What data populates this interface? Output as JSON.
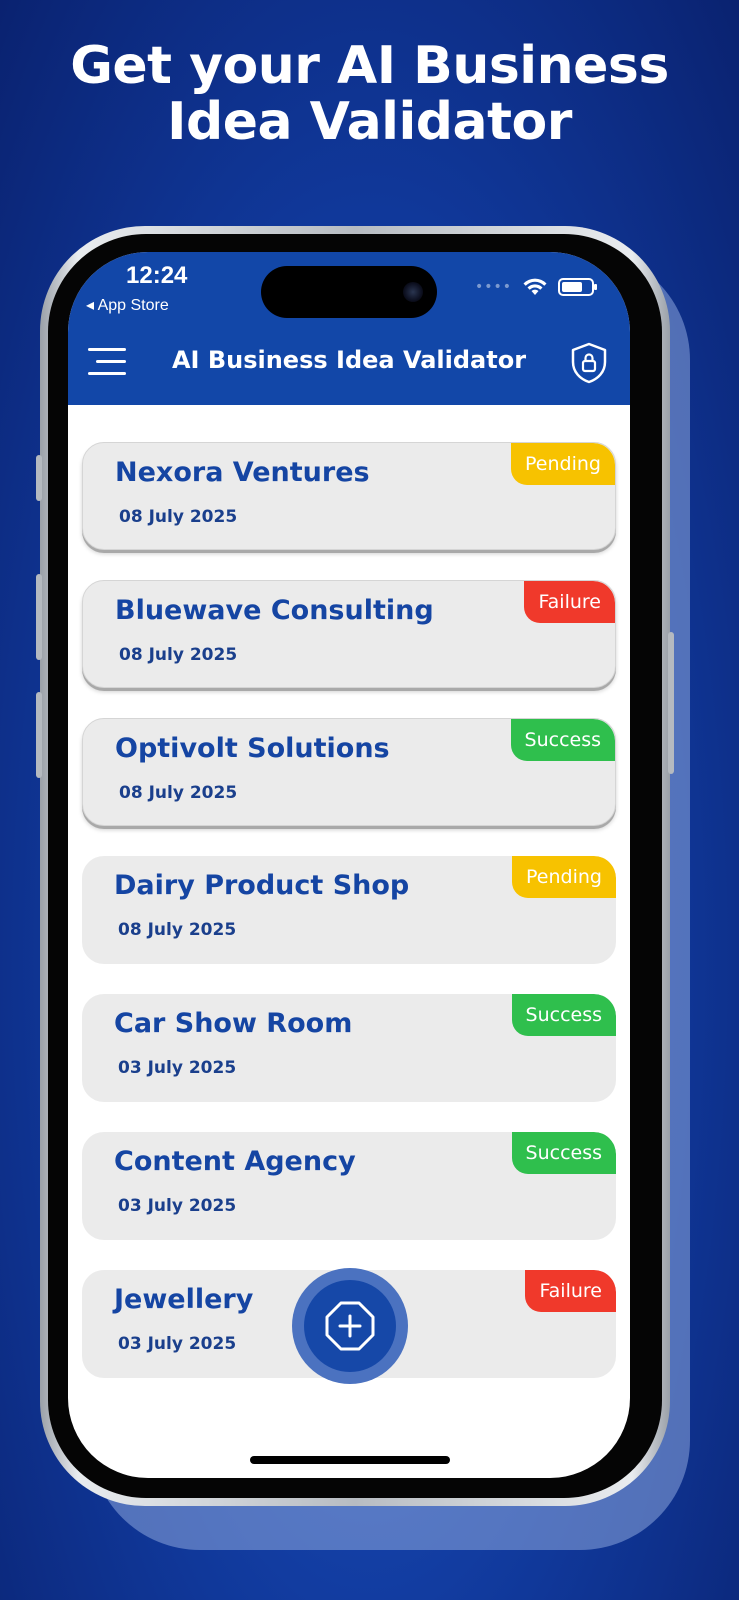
{
  "promo": {
    "title_line1": "Get your AI Business",
    "title_line2": "Idea Validator"
  },
  "status_bar": {
    "time": "12:24",
    "back_label": "◂ App Store",
    "battery_percent": 70
  },
  "header": {
    "title": "AI Business Idea Validator",
    "menu_icon": "menu-icon",
    "right_icon": "shield-lock-icon"
  },
  "ideas": [
    {
      "name": "Nexora Ventures",
      "date": "08 July 2025",
      "status": "Pending"
    },
    {
      "name": "Bluewave Consulting",
      "date": "08 July 2025",
      "status": "Failure"
    },
    {
      "name": "Optivolt Solutions",
      "date": "08 July 2025",
      "status": "Success"
    },
    {
      "name": "Dairy Product Shop",
      "date": "08 July 2025",
      "status": "Pending"
    },
    {
      "name": "Car Show Room",
      "date": "03 July 2025",
      "status": "Success"
    },
    {
      "name": "Content Agency",
      "date": "03 July 2025",
      "status": "Success"
    },
    {
      "name": "Jewellery",
      "date": "03 July 2025",
      "status": "Failure"
    }
  ],
  "fab": {
    "icon": "add-octagon-icon"
  },
  "colors": {
    "brand_blue": "#1247a8",
    "pending": "#f7c200",
    "failure": "#f0392b",
    "success": "#2fbf4d",
    "card_bg": "#ebebeb"
  }
}
